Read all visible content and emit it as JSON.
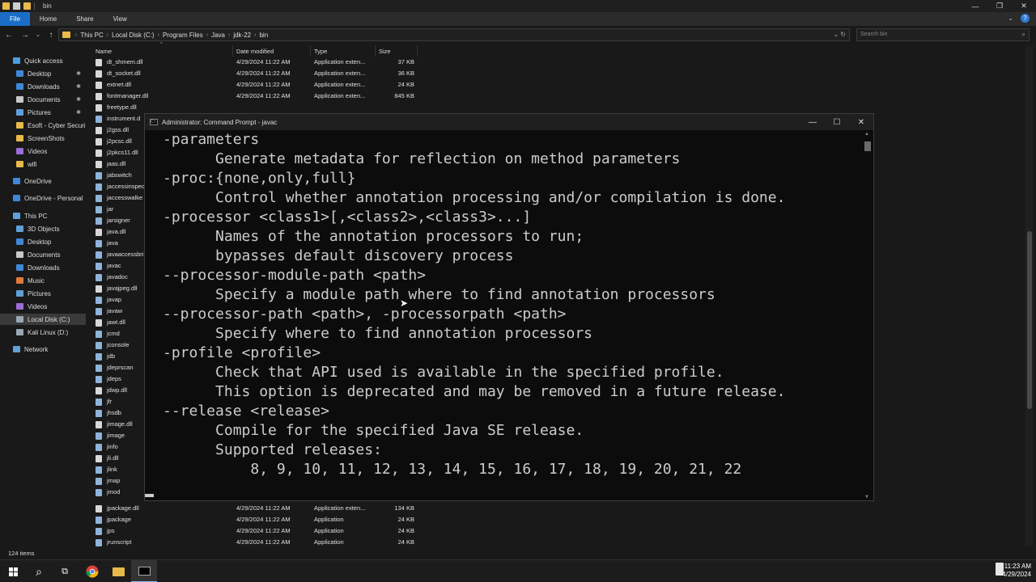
{
  "explorer": {
    "window_title": "bin",
    "ribbon_tabs": [
      "File",
      "Home",
      "Share",
      "View"
    ],
    "breadcrumb": [
      "This PC",
      "Local Disk (C:)",
      "Program Files",
      "Java",
      "jdk-22",
      "bin"
    ],
    "search_placeholder": "Search bin",
    "columns": {
      "name": "Name",
      "date": "Date modified",
      "type": "Type",
      "size": "Size"
    },
    "status_items": "124 items",
    "nav": [
      {
        "label": "Quick access",
        "icon": "star-icon",
        "color": "#4a9de0"
      },
      {
        "label": "Desktop",
        "icon": "desktop-icon",
        "color": "#3f88d8",
        "pinned": true
      },
      {
        "label": "Downloads",
        "icon": "download-icon",
        "color": "#3f88d8",
        "pinned": true
      },
      {
        "label": "Documents",
        "icon": "documents-icon",
        "color": "#c9c9c9",
        "pinned": true
      },
      {
        "label": "Pictures",
        "icon": "pictures-icon",
        "color": "#5fa0d9",
        "pinned": true
      },
      {
        "label": "Esoft - Cyber Securi",
        "icon": "folder-icon",
        "color": "#e9b949"
      },
      {
        "label": "ScreenShots",
        "icon": "folder-icon",
        "color": "#e9b949"
      },
      {
        "label": "Videos",
        "icon": "videos-icon",
        "color": "#9a6dd7"
      },
      {
        "label": "wifi",
        "icon": "folder-icon",
        "color": "#e9b949"
      },
      {
        "label": "OneDrive",
        "icon": "cloud-icon",
        "color": "#3f88d8"
      },
      {
        "label": "OneDrive - Personal",
        "icon": "cloud-icon",
        "color": "#3f88d8"
      },
      {
        "label": "This PC",
        "icon": "computer-icon",
        "color": "#5fa0d9"
      },
      {
        "label": "3D Objects",
        "icon": "cube-icon",
        "color": "#5fa0d9"
      },
      {
        "label": "Desktop",
        "icon": "desktop-icon",
        "color": "#3f88d8"
      },
      {
        "label": "Documents",
        "icon": "documents-icon",
        "color": "#c9c9c9"
      },
      {
        "label": "Downloads",
        "icon": "download-icon",
        "color": "#3f88d8"
      },
      {
        "label": "Music",
        "icon": "music-icon",
        "color": "#e07a3a"
      },
      {
        "label": "Pictures",
        "icon": "pictures-icon",
        "color": "#5fa0d9"
      },
      {
        "label": "Videos",
        "icon": "videos-icon",
        "color": "#9a6dd7"
      },
      {
        "label": "Local Disk (C:)",
        "icon": "drive-icon",
        "color": "#9aa7b4",
        "selected": true
      },
      {
        "label": "Kali Linux (D:)",
        "icon": "drive-icon",
        "color": "#9aa7b4"
      },
      {
        "label": "Network",
        "icon": "network-icon",
        "color": "#5fa0d9"
      }
    ],
    "files": [
      {
        "name": "dt_shmem.dll",
        "date": "4/29/2024 11:22 AM",
        "type": "Application exten...",
        "size": "37 KB"
      },
      {
        "name": "dt_socket.dll",
        "date": "4/29/2024 11:22 AM",
        "type": "Application exten...",
        "size": "36 KB"
      },
      {
        "name": "extnet.dll",
        "date": "4/29/2024 11:22 AM",
        "type": "Application exten...",
        "size": "24 KB"
      },
      {
        "name": "fontmanager.dll",
        "date": "4/29/2024 11:22 AM",
        "type": "Application exten...",
        "size": "845 KB"
      },
      {
        "name": "freetype.dll",
        "date": "",
        "type": "",
        "size": ""
      },
      {
        "name": "instrument.d",
        "date": "",
        "type": "",
        "size": ""
      },
      {
        "name": "j2gss.dll",
        "date": "",
        "type": "",
        "size": ""
      },
      {
        "name": "j2pcsc.dll",
        "date": "",
        "type": "",
        "size": ""
      },
      {
        "name": "j2pkcs11.dll",
        "date": "",
        "type": "",
        "size": ""
      },
      {
        "name": "jaas.dll",
        "date": "",
        "type": "",
        "size": ""
      },
      {
        "name": "jabswitch",
        "date": "",
        "type": "",
        "size": ""
      },
      {
        "name": "jaccessinspec",
        "date": "",
        "type": "",
        "size": ""
      },
      {
        "name": "jaccesswalke",
        "date": "",
        "type": "",
        "size": ""
      },
      {
        "name": "jar",
        "date": "",
        "type": "",
        "size": ""
      },
      {
        "name": "jarsigner",
        "date": "",
        "type": "",
        "size": ""
      },
      {
        "name": "java.dll",
        "date": "",
        "type": "",
        "size": ""
      },
      {
        "name": "java",
        "date": "",
        "type": "",
        "size": ""
      },
      {
        "name": "javaaccessbri",
        "date": "",
        "type": "",
        "size": ""
      },
      {
        "name": "javac",
        "date": "",
        "type": "",
        "size": ""
      },
      {
        "name": "javadoc",
        "date": "",
        "type": "",
        "size": ""
      },
      {
        "name": "javajpeg.dll",
        "date": "",
        "type": "",
        "size": ""
      },
      {
        "name": "javap",
        "date": "",
        "type": "",
        "size": ""
      },
      {
        "name": "javaw",
        "date": "",
        "type": "",
        "size": ""
      },
      {
        "name": "jawt.dll",
        "date": "",
        "type": "",
        "size": ""
      },
      {
        "name": "jcmd",
        "date": "",
        "type": "",
        "size": ""
      },
      {
        "name": "jconsole",
        "date": "",
        "type": "",
        "size": ""
      },
      {
        "name": "jdb",
        "date": "",
        "type": "",
        "size": ""
      },
      {
        "name": "jdeprscan",
        "date": "",
        "type": "",
        "size": ""
      },
      {
        "name": "jdeps",
        "date": "",
        "type": "",
        "size": ""
      },
      {
        "name": "jdwp.dll",
        "date": "",
        "type": "",
        "size": ""
      },
      {
        "name": "jfr",
        "date": "",
        "type": "",
        "size": ""
      },
      {
        "name": "jhsdb",
        "date": "",
        "type": "",
        "size": ""
      },
      {
        "name": "jimage.dll",
        "date": "",
        "type": "",
        "size": ""
      },
      {
        "name": "jimage",
        "date": "",
        "type": "",
        "size": ""
      },
      {
        "name": "jinfo",
        "date": "",
        "type": "",
        "size": ""
      },
      {
        "name": "jli.dll",
        "date": "",
        "type": "",
        "size": ""
      },
      {
        "name": "jlink",
        "date": "",
        "type": "",
        "size": ""
      },
      {
        "name": "jmap",
        "date": "",
        "type": "",
        "size": ""
      },
      {
        "name": "jmod",
        "date": "",
        "type": "",
        "size": ""
      },
      {
        "name": "jpackage.dll",
        "date": "4/29/2024 11:22 AM",
        "type": "Application exten...",
        "size": "134 KB"
      },
      {
        "name": "jpackage",
        "date": "4/29/2024 11:22 AM",
        "type": "Application",
        "size": "24 KB"
      },
      {
        "name": "jps",
        "date": "4/29/2024 11:22 AM",
        "type": "Application",
        "size": "24 KB"
      },
      {
        "name": "jrunscript",
        "date": "4/29/2024 11:22 AM",
        "type": "Application",
        "size": "24 KB"
      }
    ]
  },
  "cmd": {
    "title": "Administrator: Command Prompt - javac",
    "icon_text": "C:\\",
    "lines": [
      "-parameters",
      "      Generate metadata for reflection on method parameters",
      "-proc:{none,only,full}",
      "      Control whether annotation processing and/or compilation is done.",
      "-processor <class1>[,<class2>,<class3>...]",
      "      Names of the annotation processors to run;",
      "      bypasses default discovery process",
      "--processor-module-path <path>",
      "      Specify a module path where to find annotation processors",
      "--processor-path <path>, -processorpath <path>",
      "      Specify where to find annotation processors",
      "-profile <profile>",
      "      Check that API used is available in the specified profile.",
      "      This option is deprecated and may be removed in a future release.",
      "--release <release>",
      "      Compile for the specified Java SE release.",
      "      Supported releases:",
      "          8, 9, 10, 11, 12, 13, 14, 15, 16, 17, 18, 19, 20, 21, 22"
    ]
  },
  "taskbar": {
    "time": "11:23 AM",
    "date": "4/29/2024"
  }
}
